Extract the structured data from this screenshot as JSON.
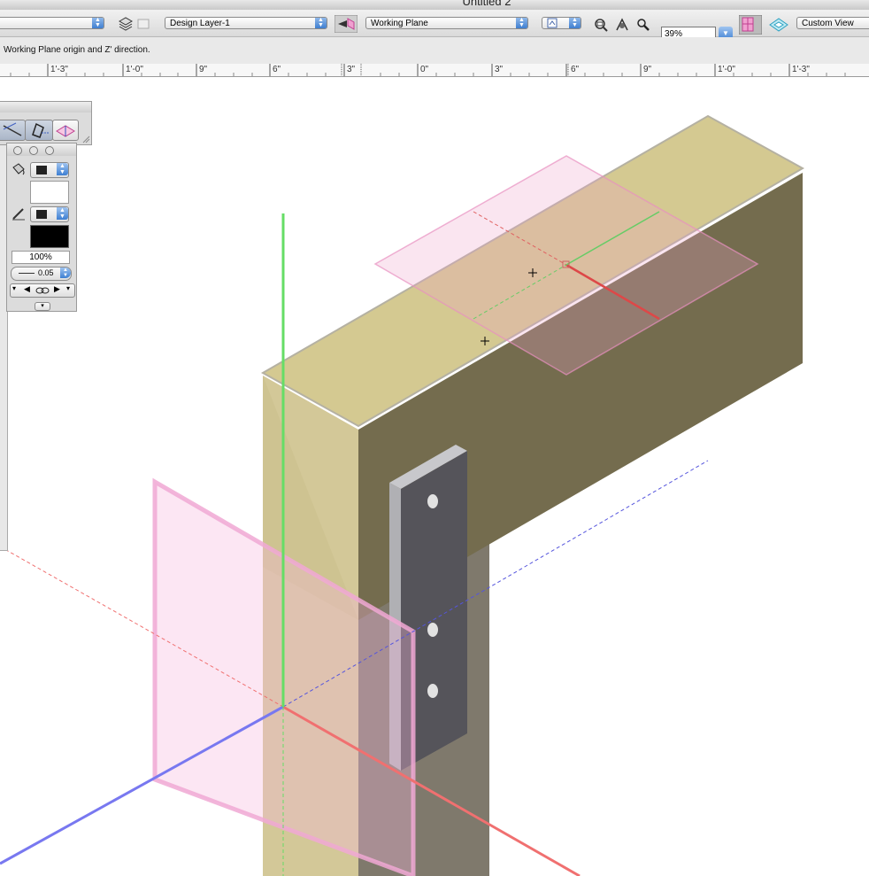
{
  "window": {
    "title": "Untitled 2"
  },
  "toolbar": {
    "class_popup": "",
    "layer_popup": "Design Layer-1",
    "plane_popup": "Working Plane",
    "zoom_value": "39%",
    "view_popup": "Custom View"
  },
  "message_bar": {
    "text": "Working Plane origin and Z' direction."
  },
  "ruler": {
    "labels": [
      "1'-3\"",
      "1'-0\"",
      "9\"",
      "6\"",
      "3\"",
      "0\"",
      "3\"",
      "6\"",
      "9\"",
      "1'-0\"",
      "1'-3\""
    ]
  },
  "attributes": {
    "opacity": "100%",
    "line_weight": "0.05",
    "fill_color": "#ffffff",
    "pen_color": "#000000"
  },
  "icons": [
    "layers-icon",
    "flyover-icon",
    "working-plane-icon",
    "sheet-icon",
    "zoom-in-icon",
    "pan-icon",
    "magnifier-icon",
    "standard-views-icon",
    "projection-icon",
    "paint-bucket-icon",
    "pencil-icon",
    "link-icon"
  ],
  "colors": {
    "beam_top": "#d4c991",
    "beam_side": "#746c4e",
    "plate": "#55545a",
    "x_axis": "#f07070",
    "y_axis": "#66dd66",
    "z_axis": "#7878f0",
    "working_plane": "#f5b7dc"
  }
}
